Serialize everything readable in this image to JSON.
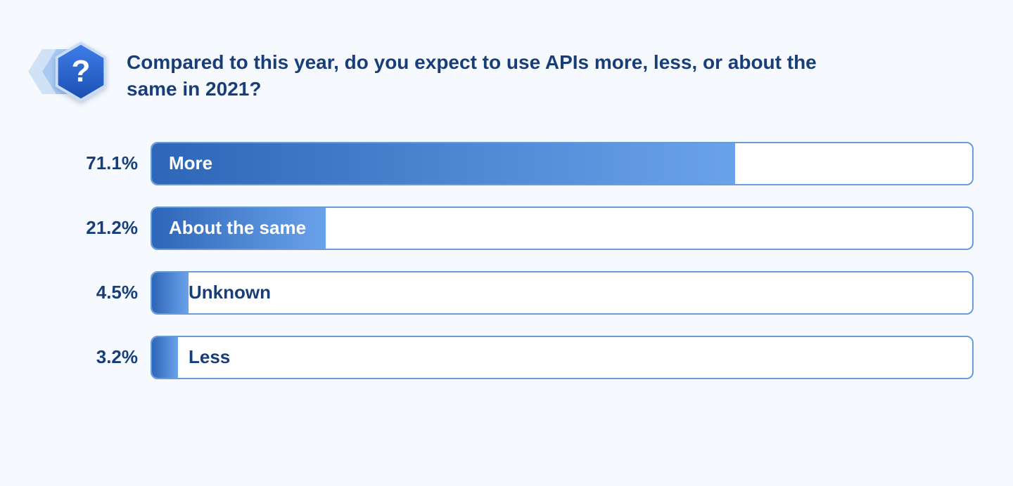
{
  "question": "Compared to this year, do you expect to use APIs more, less, or about the same in 2021?",
  "chart_data": {
    "type": "bar",
    "orientation": "horizontal",
    "categories": [
      "More",
      "About the same",
      "Unknown",
      "Less"
    ],
    "values": [
      71.1,
      21.2,
      4.5,
      3.2
    ],
    "value_labels": [
      "71.1%",
      "21.2%",
      "4.5%",
      "3.2%"
    ],
    "label_inside": [
      true,
      true,
      false,
      false
    ],
    "xlabel": "",
    "ylabel": "",
    "xlim": [
      0,
      100
    ],
    "title": "Compared to this year, do you expect to use APIs more, less, or about the same in 2021?"
  }
}
